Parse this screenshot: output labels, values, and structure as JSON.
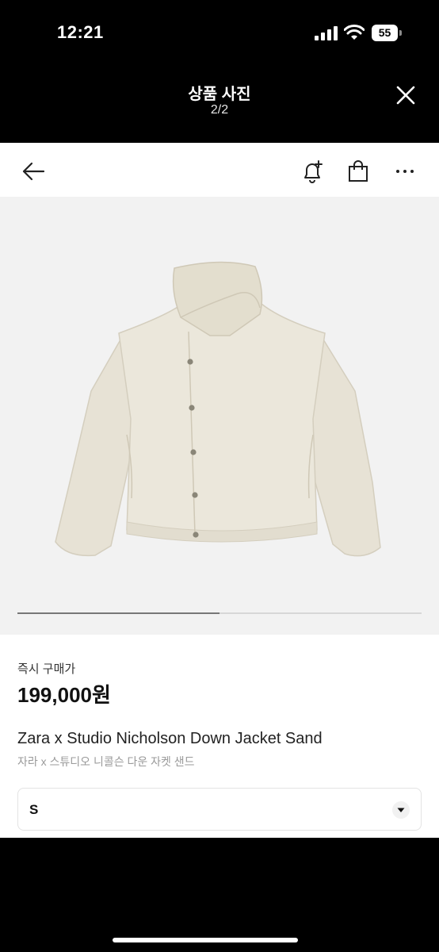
{
  "status_bar": {
    "time": "12:21",
    "battery_level": "55",
    "icons": [
      "signal-icon",
      "wifi-icon",
      "battery-icon"
    ]
  },
  "viewer": {
    "title": "상품 사진",
    "counter": "2/2",
    "close_icon": "close-icon"
  },
  "app_bar": {
    "icons": [
      "back-arrow-icon",
      "bell-plus-icon",
      "shopping-bag-icon",
      "more-icon"
    ]
  },
  "gallery": {
    "image": "jacket-photo",
    "indicator_progress": 0.5
  },
  "product": {
    "price_label": "즉시 구매가",
    "price": "199,000원",
    "name": "Zara x Studio Nicholson Down Jacket Sand",
    "subname": "자라 x 스튜디오 니콜슨 다운 자켓 샌드",
    "selected_size": "S"
  },
  "colors": {
    "jacket": "#e6e1d3",
    "gallery_bg": "#f2f2f2",
    "text": "#111111"
  }
}
